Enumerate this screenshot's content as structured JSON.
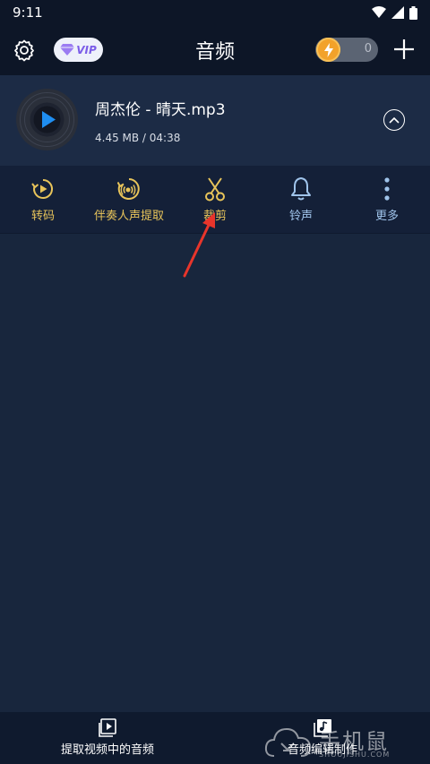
{
  "status_bar": {
    "time": "9:11"
  },
  "header": {
    "title": "音频",
    "vip_label": "VIP",
    "coin_count": "0"
  },
  "file": {
    "name": "周杰伦 - 晴天.mp3",
    "meta": "4.45 MB / 04:38"
  },
  "actions": [
    {
      "label": "转码",
      "icon": "transcode-icon",
      "color": "#e8c45a"
    },
    {
      "label": "伴奏人声提取",
      "icon": "vocal-extract-icon",
      "color": "#e8c45a"
    },
    {
      "label": "裁剪",
      "icon": "scissors-icon",
      "color": "#e8c45a"
    },
    {
      "label": "铃声",
      "icon": "bell-icon",
      "color": "#9fc3ea"
    },
    {
      "label": "更多",
      "icon": "more-icon",
      "color": "#9fc3ea"
    }
  ],
  "bottom_nav": {
    "extract_label": "提取视频中的音频",
    "edit_label": "音频编辑制作"
  },
  "watermark": {
    "text": "手机鼠",
    "url": "SHOUJISHU.COM"
  },
  "colors": {
    "background": "#18263d",
    "header": "#0d1627",
    "accent_gold": "#e8c45a",
    "accent_blue": "#9fc3ea",
    "annotation_arrow": "#e8352b"
  }
}
